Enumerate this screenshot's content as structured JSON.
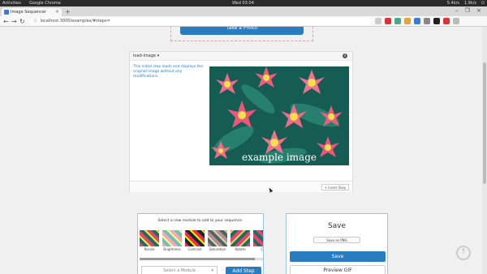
{
  "os_bar": {
    "activities": "Activities",
    "app": "Google Chrome",
    "clock": "Wed 03:04",
    "net_down": "5.4k/s",
    "net_up": "1.9k/s"
  },
  "browser": {
    "tab_title": "Image Sequencer",
    "tab_close": "×",
    "new_tab": "+",
    "window_controls": "– ❐ ×",
    "url": "localhost:3000/examples/#steps=",
    "icons": [
      "back-arrow-icon",
      "forward-arrow-icon",
      "reload-icon",
      "lock-icon"
    ]
  },
  "page": {
    "take_photo_label": "Take a Photo",
    "step": {
      "title": "load-image",
      "caret": "▾",
      "info_icon": "i",
      "description": "This initial step loads and displays the original image without any modifications.",
      "image_caption": "example image",
      "insert_step_label": "+ Insert Step"
    },
    "modules": {
      "hint": "Select a new module to add to your sequence.",
      "items": [
        {
          "label": "Resize"
        },
        {
          "label": "Brightness"
        },
        {
          "label": "Contrast"
        },
        {
          "label": "Saturation"
        },
        {
          "label": "Rotate"
        },
        {
          "label": "Ch"
        }
      ],
      "select_placeholder": "Select a Module",
      "select_caret": "▾",
      "add_step_label": "Add Step"
    },
    "save": {
      "title": "Save",
      "format": "Save as PNG",
      "save_label": "Save",
      "preview_label": "Preview GIF"
    },
    "scroll_top_icon": "↑"
  },
  "colors": {
    "primary": "#2a7cc1",
    "panel_border": "#9dc3e6"
  }
}
